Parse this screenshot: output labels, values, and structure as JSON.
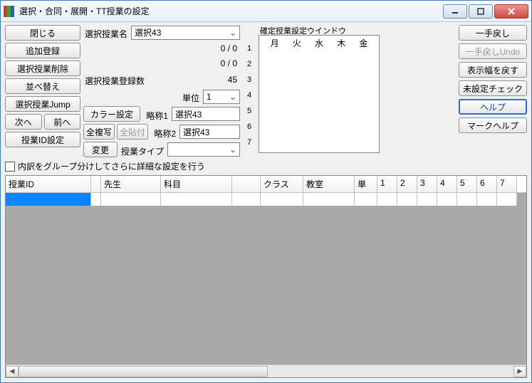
{
  "window": {
    "title": "選択・合同・展開・TT授業の設定"
  },
  "left": {
    "close": "閉じる",
    "add": "追加登録",
    "del": "選択授業削除",
    "sort": "並べ替え",
    "jump": "選択授業Jump",
    "next": "次へ",
    "prev": "前へ",
    "idset": "授業ID設定"
  },
  "mid": {
    "name_lbl": "選択授業名",
    "name_val": "選択43",
    "ratio1": "0 / 0",
    "ratio2": "0 / 0",
    "regcount_lbl": "選択授業登録数",
    "regcount_val": "45",
    "unit_lbl": "単位",
    "unit_val": "1",
    "color": "カラー設定",
    "abbr1_lbl": "略称1",
    "abbr1_val": "選択43",
    "abbr2_lbl": "略称2",
    "abbr2_val": "選択43",
    "copyall": "全複写",
    "pasteall": "全貼付",
    "change": "変更",
    "type_lbl": "授業タイプ"
  },
  "kakutei": {
    "title": "確定授業設定ウインドウ",
    "days": [
      "月",
      "火",
      "水",
      "木",
      "金"
    ],
    "rows": [
      "1",
      "2",
      "3",
      "4",
      "5",
      "6",
      "7"
    ]
  },
  "right": {
    "undo": "一手戻し",
    "undo2": "一手戻しUndo",
    "width": "表示幅を戻す",
    "unset": "未設定チェック",
    "help": "ヘルプ",
    "markhelp": "マークヘルプ"
  },
  "checkbox": {
    "label": "内訳をグループ分けしてさらに詳細な設定を行う"
  },
  "grid": {
    "headers": [
      "授業ID",
      "",
      "先生",
      "科目",
      "",
      "クラス",
      "教室",
      "単",
      "1",
      "2",
      "3",
      "4",
      "5",
      "6",
      "7"
    ],
    "widths": [
      120,
      14,
      84,
      100,
      40,
      60,
      72,
      32,
      28,
      28,
      28,
      28,
      28,
      28,
      28
    ]
  }
}
